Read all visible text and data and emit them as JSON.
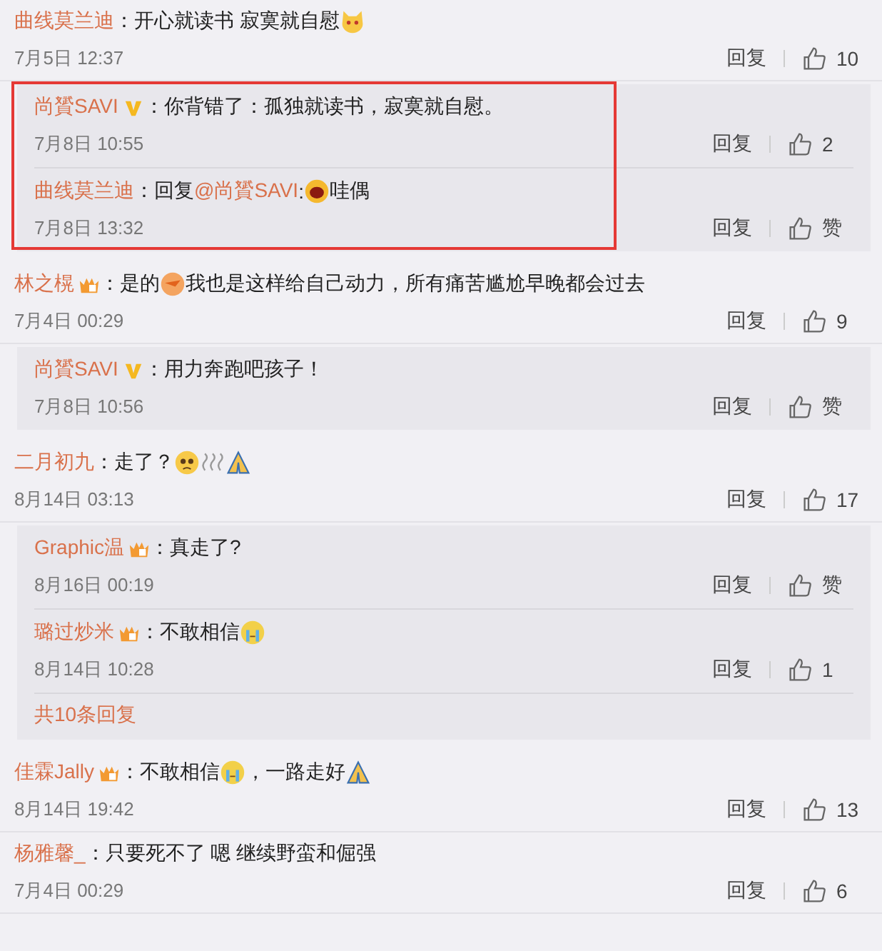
{
  "comments": [
    {
      "user": "曲线莫兰迪",
      "parts": [
        {
          "kind": "text",
          "text": "：开心就读书 寂寞就自慰"
        },
        {
          "kind": "cat"
        }
      ],
      "time": "7月5日 12:37",
      "reply_label": "回复",
      "likes": "10",
      "replies_highlighted": true,
      "replies": [
        {
          "user": "尚贇SAVI",
          "badge": {
            "kind": "v"
          },
          "parts": [
            {
              "kind": "text",
              "text": "：你背错了：孤独就读书，寂寞就自慰。"
            }
          ],
          "time": "7月8日 10:55",
          "reply_label": "回复",
          "likes": "2"
        },
        {
          "user": "曲线莫兰迪",
          "parts": [
            {
              "kind": "text",
              "text": "：回复"
            },
            {
              "kind": "mention",
              "text": "@尚贇SAVI"
            },
            {
              "kind": "text",
              "text": ":"
            },
            {
              "kind": "laugh"
            },
            {
              "kind": "text",
              "text": "哇偶"
            }
          ],
          "time": "7月8日 13:32",
          "reply_label": "回复",
          "likes": "赞"
        }
      ]
    },
    {
      "user": "林之榥",
      "badge": {
        "kind": "crown"
      },
      "parts": [
        {
          "kind": "text",
          "text": "：是的"
        },
        {
          "kind": "orange"
        },
        {
          "kind": "text",
          "text": "我也是这样给自己动力，所有痛苦尴尬早晚都会过去"
        }
      ],
      "time": "7月4日 00:29",
      "reply_label": "回复",
      "likes": "9",
      "replies_highlighted": false,
      "replies": [
        {
          "user": "尚贇SAVI",
          "badge": {
            "kind": "v"
          },
          "parts": [
            {
              "kind": "text",
              "text": "：用力奔跑吧孩子！"
            }
          ],
          "time": "7月8日 10:56",
          "reply_label": "回复",
          "likes": "赞"
        }
      ]
    },
    {
      "user": "二月初九",
      "parts": [
        {
          "kind": "text",
          "text": "：走了？"
        },
        {
          "kind": "sad"
        },
        {
          "kind": "wind"
        },
        {
          "kind": "pray"
        }
      ],
      "time": "8月14日 03:13",
      "reply_label": "回复",
      "likes": "17",
      "replies_highlighted": false,
      "replies": [
        {
          "user": "Graphic温",
          "badge": {
            "kind": "crown"
          },
          "parts": [
            {
              "kind": "text",
              "text": "：真走了?"
            }
          ],
          "time": "8月16日 00:19",
          "reply_label": "回复",
          "likes": "赞"
        },
        {
          "user": "璐过炒米",
          "badge": {
            "kind": "crown"
          },
          "parts": [
            {
              "kind": "text",
              "text": "：不敢相信"
            },
            {
              "kind": "cry"
            }
          ],
          "time": "8月14日 10:28",
          "reply_label": "回复",
          "likes": "1"
        }
      ],
      "more": "共10条回复"
    },
    {
      "user": "佳霖Jally",
      "badge": {
        "kind": "crown"
      },
      "parts": [
        {
          "kind": "text",
          "text": "：不敢相信"
        },
        {
          "kind": "cry"
        },
        {
          "kind": "text",
          "text": "，一路走好"
        },
        {
          "kind": "pray"
        }
      ],
      "time": "8月14日 19:42",
      "reply_label": "回复",
      "likes": "13"
    },
    {
      "user": "杨雅馨_",
      "parts": [
        {
          "kind": "text",
          "text": "：只要死不了 嗯 继续野蛮和倔强"
        }
      ],
      "time": "7月4日 00:29",
      "reply_label": "回复",
      "likes": "6"
    }
  ]
}
